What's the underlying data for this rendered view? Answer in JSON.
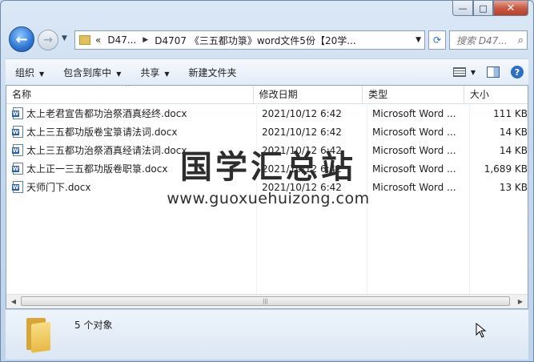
{
  "window": {
    "caption_buttons": {
      "minimize": "—",
      "maximize": "□",
      "close": "✕"
    }
  },
  "nav": {
    "address": {
      "overflow": "«",
      "segments": [
        "D47...",
        "D4707 《三五都功箓》word文件5份【20学..."
      ]
    },
    "search_placeholder": "搜索 D47..."
  },
  "toolbar": {
    "organize": "组织",
    "include_library": "包含到库中",
    "share": "共享",
    "new_folder": "新建文件夹"
  },
  "columns": {
    "name": "名称",
    "date": "修改日期",
    "type": "类型",
    "size": "大小"
  },
  "files": [
    {
      "name": "太上老君宣告都功治祭酒真经终.docx",
      "date": "2021/10/12 6:42",
      "type": "Microsoft Word ...",
      "size": "111 KB"
    },
    {
      "name": "太上三五都功版卷宝箓请法词.docx",
      "date": "2021/10/12 6:42",
      "type": "Microsoft Word ...",
      "size": "14 KB"
    },
    {
      "name": "太上三五都功治祭酒真经请法词.docx",
      "date": "2021/10/12 6:42",
      "type": "Microsoft Word ...",
      "size": "14 KB"
    },
    {
      "name": "太上正一三五都功版卷职箓.docx",
      "date": "2021/10/12 6:42",
      "type": "Microsoft Word ...",
      "size": "1,689 KB"
    },
    {
      "name": "天师门下.docx",
      "date": "2021/10/12 6:42",
      "type": "Microsoft Word ...",
      "size": "13 KB"
    }
  ],
  "watermark": {
    "title": "国学汇总站",
    "url": "www.guoxuehuizong.com"
  },
  "status": {
    "count_text": "5 个对象"
  },
  "colors": {
    "accent": "#2e6fc2",
    "chrome": "#c9dcef"
  }
}
